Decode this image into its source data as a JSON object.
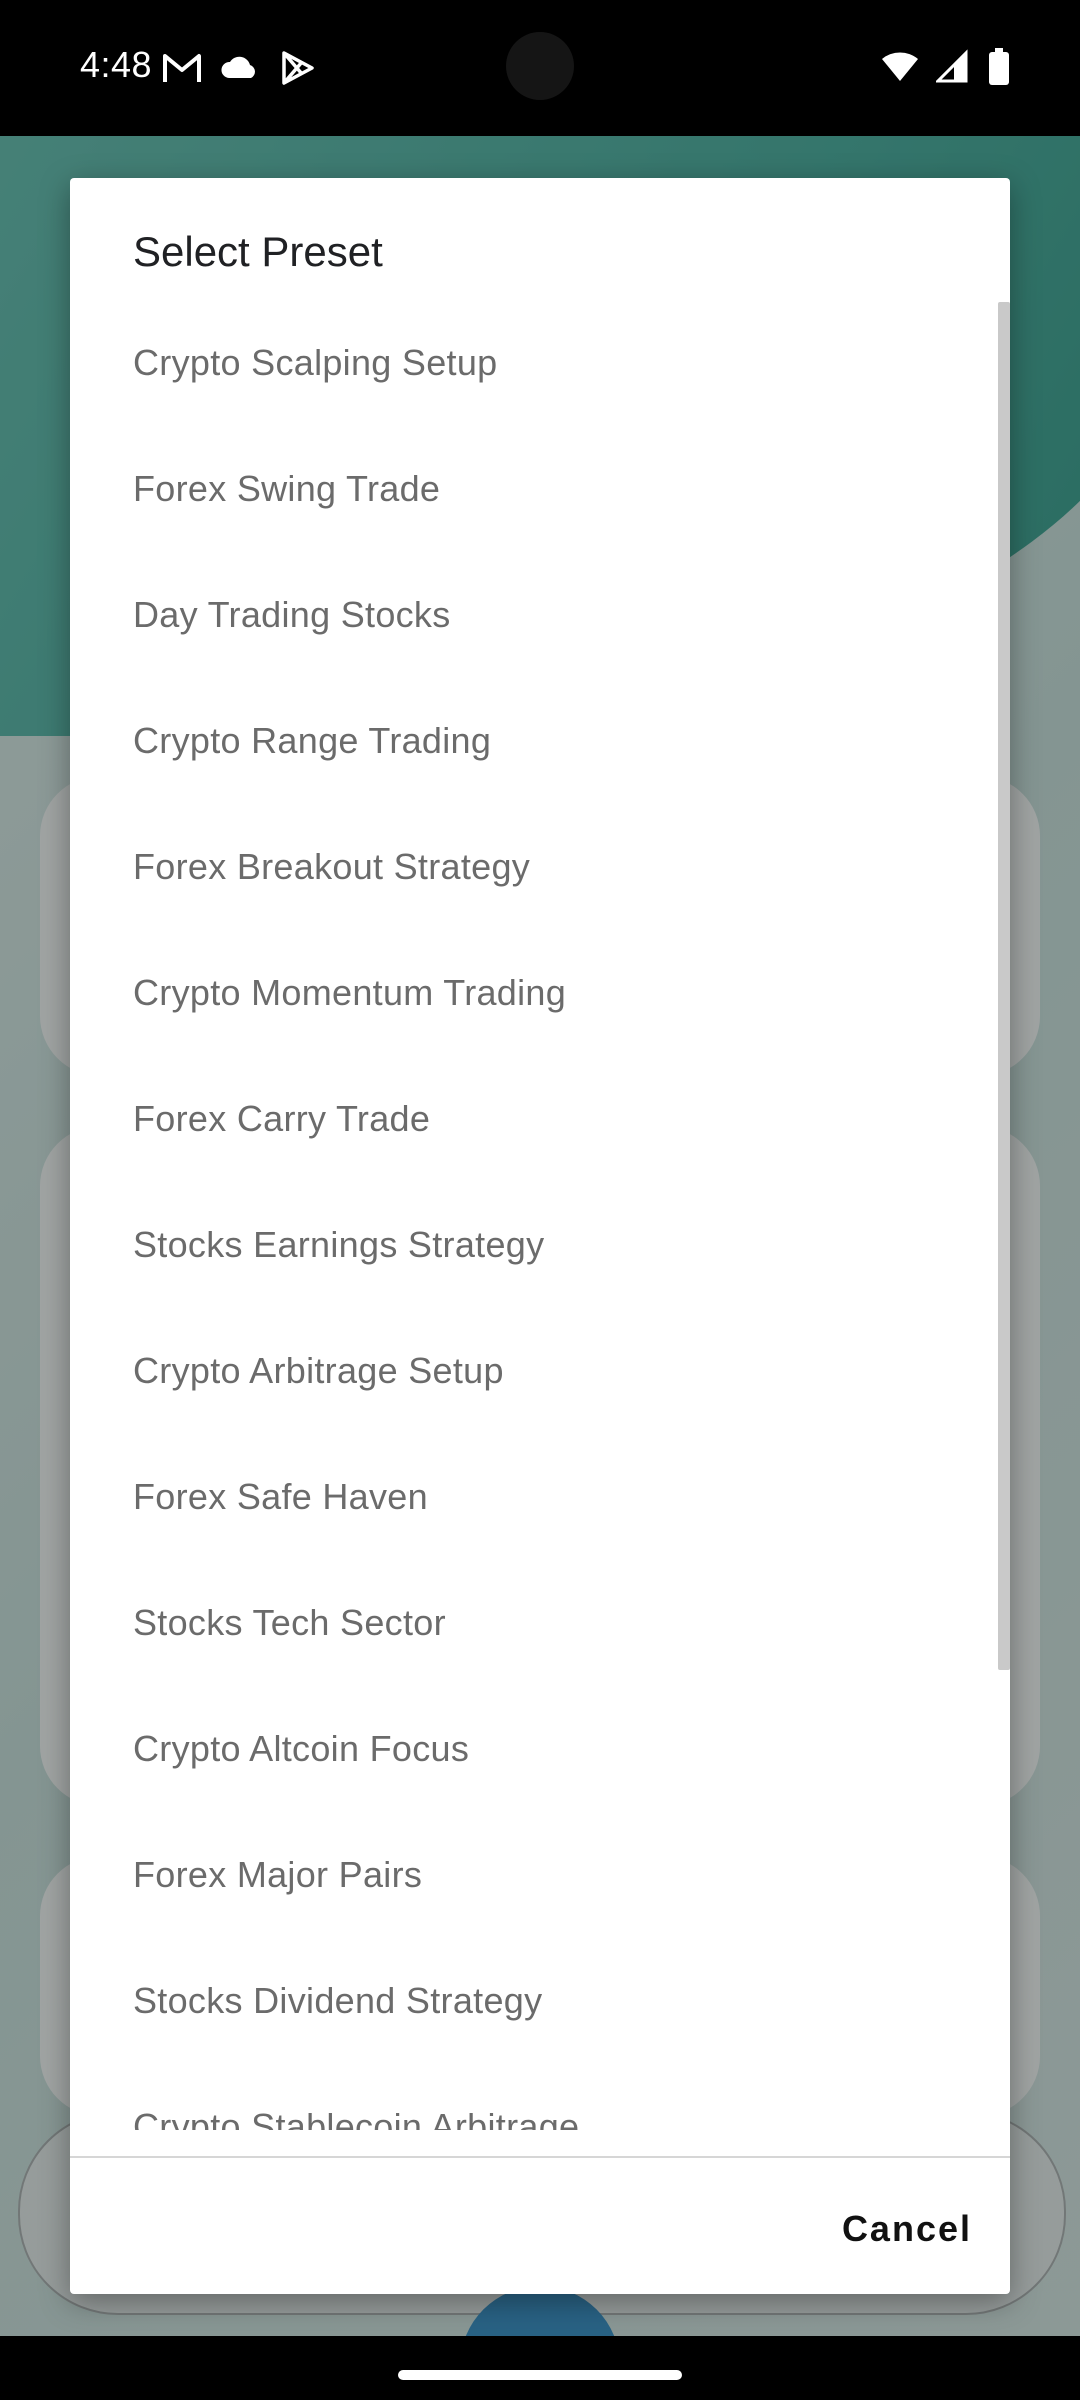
{
  "status_bar": {
    "time": "4:48",
    "left_icons": [
      "gmail-icon",
      "cloud-icon",
      "play-store-icon"
    ],
    "right_icons": [
      "wifi-icon",
      "signal-icon",
      "battery-icon"
    ]
  },
  "dialog": {
    "title": "Select Preset",
    "items": [
      "Crypto Scalping Setup",
      "Forex Swing Trade",
      "Day Trading Stocks",
      "Crypto Range Trading",
      "Forex Breakout Strategy",
      "Crypto Momentum Trading",
      "Forex Carry Trade",
      "Stocks Earnings Strategy",
      "Crypto Arbitrage Setup",
      "Forex Safe Haven",
      "Stocks Tech Sector",
      "Crypto Altcoin Focus",
      "Forex Major Pairs",
      "Stocks Dividend Strategy",
      "Crypto Stablecoin Arbitrage"
    ],
    "cancel_label": "Cancel"
  },
  "colors": {
    "accent": "#2f9f8e",
    "scrim": "#3c3c3c",
    "item_text": "#6b6b6b"
  }
}
